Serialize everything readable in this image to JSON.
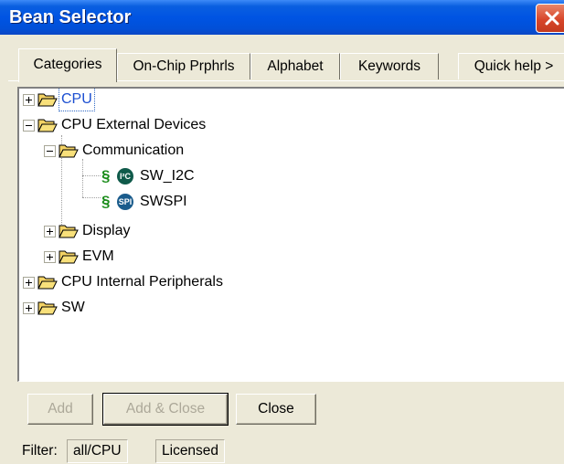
{
  "window": {
    "title": "Bean Selector"
  },
  "tabs": [
    {
      "label": "Categories",
      "active": true
    },
    {
      "label": "On-Chip Prphrls",
      "active": false
    },
    {
      "label": "Alphabet",
      "active": false
    },
    {
      "label": "Keywords",
      "active": false
    }
  ],
  "quick_help_label": "Quick help >",
  "tree": {
    "items": [
      {
        "label": "CPU",
        "expander": "plus",
        "selected": true
      },
      {
        "label": "CPU External Devices",
        "expander": "minus"
      },
      {
        "label": "Communication",
        "expander": "minus"
      },
      {
        "label": "SW_I2C",
        "icon": "I²C"
      },
      {
        "label": "SWSPI",
        "icon": "SPI"
      },
      {
        "label": "Display",
        "expander": "plus"
      },
      {
        "label": "EVM",
        "expander": "plus"
      },
      {
        "label": "CPU Internal Peripherals",
        "expander": "plus"
      },
      {
        "label": "SW",
        "expander": "plus"
      }
    ]
  },
  "buttons": {
    "add": "Add",
    "add_close": "Add & Close",
    "close": "Close"
  },
  "status": {
    "filter_label": "Filter:",
    "filter_value": "all/CPU",
    "licensed": "Licensed"
  },
  "colors": {
    "title_bar": "#0054e3",
    "selection_text": "#1c4fd1",
    "section_mark": "#1a8c1a",
    "folder": "#f3d264"
  }
}
